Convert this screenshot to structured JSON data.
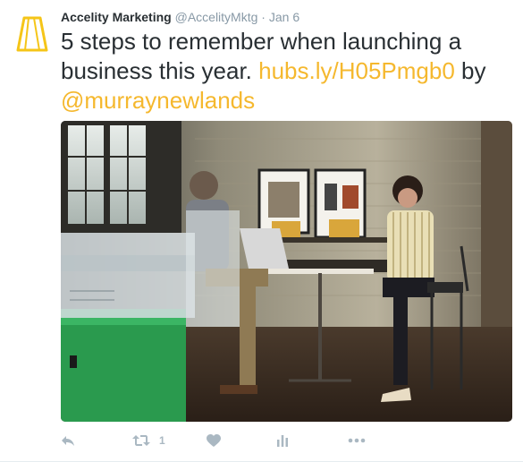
{
  "tweet": {
    "author_name": "Accelity Marketing",
    "handle": "@AccelityMktg",
    "separator": "·",
    "date": "Jan 6",
    "text_part1": "5 steps to remember when launching a business this year.",
    "link": "hubs.ly/H05Pmgb0",
    "text_part2": "by",
    "mention": "@murraynewlands"
  },
  "actions": {
    "reply_icon": "reply-icon",
    "retweet_icon": "retweet-icon",
    "retweet_count": "1",
    "like_icon": "heart-icon",
    "analytics_icon": "analytics-icon",
    "more_icon": "more-icon"
  },
  "colors": {
    "link": "#f5b82e",
    "text": "#292f33",
    "muted": "#8899a6",
    "icon": "#aab8c2",
    "logo": "#f5c518"
  }
}
